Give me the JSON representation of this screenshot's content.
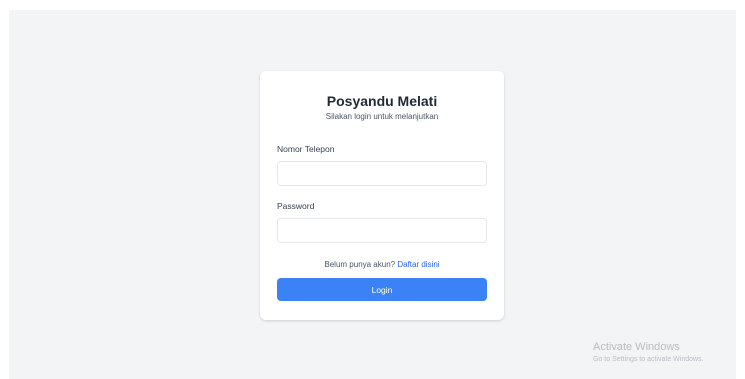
{
  "login": {
    "title": "Posyandu Melati",
    "subtitle": "Silakan login untuk melanjutkan",
    "phone_label": "Nomor Telepon",
    "phone_value": "",
    "password_label": "Password",
    "password_value": "",
    "register_prompt": "Belum punya akun?",
    "register_link": "Daftar disini",
    "login_button": "Login"
  },
  "watermark": {
    "title": "Activate Windows",
    "subtitle": "Go to Settings to activate Windows."
  },
  "colors": {
    "page_background": "#f3f4f6",
    "card_background": "#ffffff",
    "accent": "#3b82f6",
    "link": "#2563eb"
  }
}
